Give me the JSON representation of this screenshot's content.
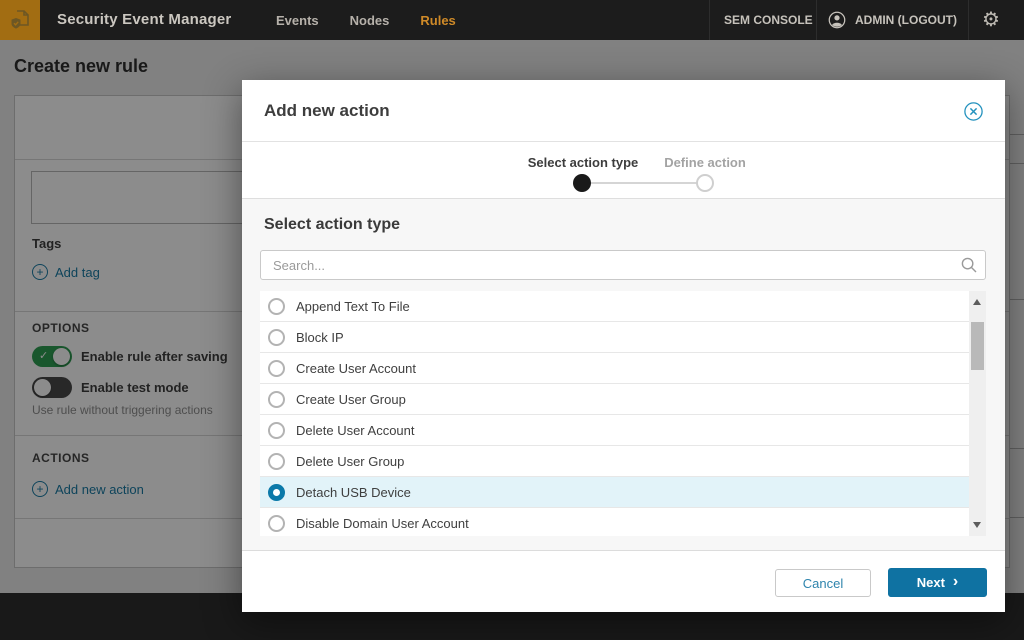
{
  "navbar": {
    "title": "Security Event Manager",
    "items": [
      {
        "label": "Events",
        "active": false
      },
      {
        "label": "Nodes",
        "active": false
      },
      {
        "label": "Rules",
        "active": true
      }
    ],
    "console_label": "SEM CONSOLE",
    "user_label": "ADMIN (LOGOUT)"
  },
  "page": {
    "title": "Create new rule",
    "tags_label": "Tags",
    "add_tag_label": "Add tag",
    "options_label": "OPTIONS",
    "toggle_enable_rule": {
      "label": "Enable rule after saving",
      "state": "on"
    },
    "toggle_test_mode": {
      "label": "Enable test mode",
      "state": "off",
      "helper": "Use rule without triggering actions"
    },
    "actions_label": "ACTIONS",
    "add_action_label": "Add new action"
  },
  "modal": {
    "title": "Add new action",
    "steps": [
      {
        "label": "Select action type",
        "active": true
      },
      {
        "label": "Define action",
        "active": false
      }
    ],
    "section_title": "Select action type",
    "search_placeholder": "Search...",
    "options": [
      {
        "label": "Append Text To File",
        "selected": false
      },
      {
        "label": "Block IP",
        "selected": false
      },
      {
        "label": "Create User Account",
        "selected": false
      },
      {
        "label": "Create User Group",
        "selected": false
      },
      {
        "label": "Delete User Account",
        "selected": false
      },
      {
        "label": "Delete User Group",
        "selected": false
      },
      {
        "label": "Detach USB Device",
        "selected": true
      },
      {
        "label": "Disable Domain User Account",
        "selected": false
      }
    ],
    "cancel_label": "Cancel",
    "next_label": "Next"
  },
  "colors": {
    "accent_blue": "#1a7ca6",
    "next_button": "#0f72a2",
    "toggle_on_green": "#2f9e53",
    "selected_row_bg": "#e2f3f9",
    "active_nav_orange": "#cf8a28",
    "logo_bg": "#a26d12"
  }
}
